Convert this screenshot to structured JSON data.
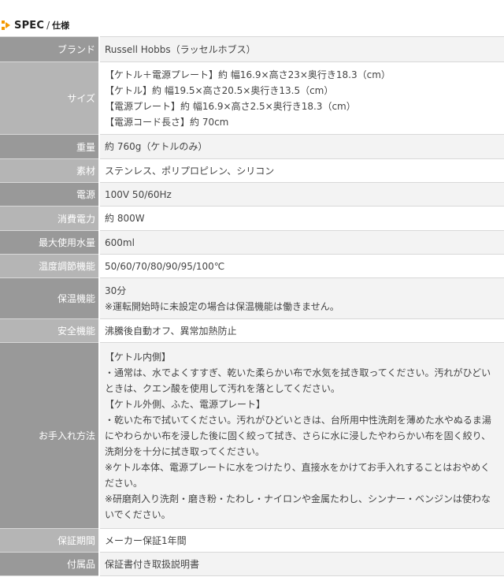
{
  "heading": {
    "title_en": "SPEC",
    "separator": "/",
    "title_ja": "仕様"
  },
  "colors": {
    "accent": "#f39800",
    "label_bg": "#999999",
    "label_bg_alt": "#b5b5b5",
    "value_bg": "#f3f3f3",
    "value_bg_alt": "#ffffff"
  },
  "spec": {
    "brand": {
      "label": "ブランド",
      "value": "Russell Hobbs（ラッセルホブス）"
    },
    "size": {
      "label": "サイズ",
      "lines": [
        "【ケトル＋電源プレート】約 幅16.9×高さ23×奥行き18.3（cm）",
        "【ケトル】約 幅19.5×高さ20.5×奥行き13.5（cm）",
        "【電源プレート】約 幅16.9×高さ2.5×奥行き18.3（cm）",
        "【電源コード長さ】約 70cm"
      ]
    },
    "weight": {
      "label": "重量",
      "value": "約 760g（ケトルのみ）"
    },
    "material": {
      "label": "素材",
      "value": "ステンレス、ポリプロピレン、シリコン"
    },
    "power": {
      "label": "電源",
      "value": "100V 50/60Hz"
    },
    "consumption": {
      "label": "消費電力",
      "value": "約 800W"
    },
    "capacity": {
      "label": "最大使用水量",
      "value": "600ml"
    },
    "temperature": {
      "label": "温度調節機能",
      "value": "50/60/70/80/90/95/100℃"
    },
    "keep_warm": {
      "label": "保温機能",
      "lines": [
        "30分",
        "※運転開始時に未設定の場合は保温機能は働きません。"
      ]
    },
    "safety": {
      "label": "安全機能",
      "value": "沸騰後自動オフ、異常加熱防止"
    },
    "care": {
      "label": "お手入れ方法",
      "lines": [
        "【ケトル内側】",
        "・通常は、水でよくすすぎ、乾いた柔らかい布で水気を拭き取ってください。汚れがひどいときは、クエン酸を使用して汚れを落としてください。",
        "【ケトル外側、ふた、電源プレート】",
        "・乾いた布で拭いてください。汚れがひどいときは、台所用中性洗剤を薄めた水やぬるま湯にやわらかい布を浸した後に固く絞って拭き、さらに水に浸したやわらかい布を固く絞り、洗剤分を十分に拭き取ってください。",
        "※ケトル本体、電源プレートに水をつけたり、直接水をかけてお手入れすることはおやめください。",
        "※研磨剤入り洗剤・磨き粉・たわし・ナイロンや金属たわし、シンナー・ベンジンは使わないでください。"
      ]
    },
    "warranty": {
      "label": "保証期間",
      "value": "メーカー保証1年間"
    },
    "accessories": {
      "label": "付属品",
      "value": "保証書付き取扱説明書"
    }
  }
}
